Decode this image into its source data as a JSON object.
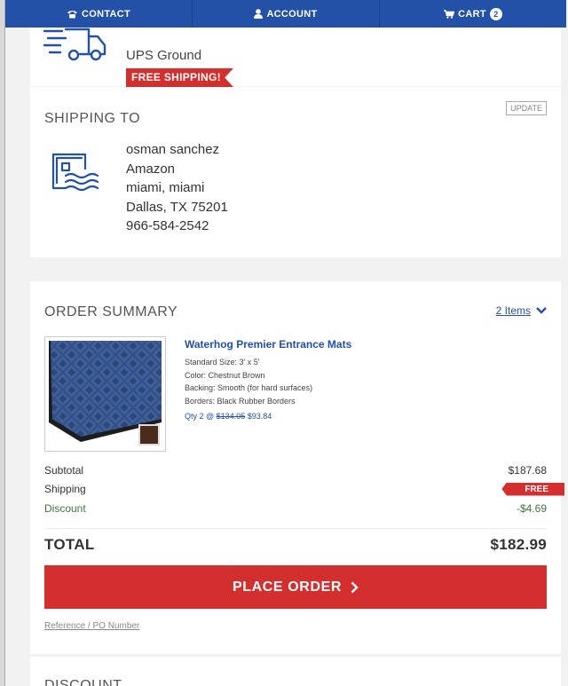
{
  "nav": {
    "contact": "CONTACT",
    "account": "ACCOUNT",
    "cart": "CART",
    "cart_count": "2"
  },
  "shipping_method": {
    "name": "UPS Ground",
    "badge": "FREE SHIPPING!"
  },
  "shipping_to": {
    "title": "SHIPPING TO",
    "update_label": "UPDATE",
    "address_lines": [
      "osman sanchez",
      "Amazon",
      "miami, miami",
      "Dallas, TX 75201",
      "966-584-2542"
    ]
  },
  "order_summary": {
    "title": "ORDER SUMMARY",
    "items_count": "2 Items",
    "product": {
      "name": "Waterhog Premier Entrance Mats",
      "attributes": [
        "Standard Size: 3' x 5'",
        "Color: Chestnut Brown",
        "Backing: Smooth (for hard surfaces)",
        "Borders: Black Rubber Borders"
      ],
      "qty_prefix": "Qty 2 @",
      "old_price": "$134.05",
      "new_price": "$93.84"
    },
    "subtotal_label": "Subtotal",
    "subtotal_value": "$187.68",
    "shipping_label": "Shipping",
    "shipping_value": "FREE",
    "discount_label": "Discount",
    "discount_value": "-$4.69",
    "total_label": "TOTAL",
    "total_value": "$182.99",
    "place_order_label": "PLACE ORDER",
    "reference_label": "Reference / PO Number"
  },
  "discount_section": {
    "title": "DISCOUNT"
  },
  "colors": {
    "nav_blue": "#2351a8",
    "accent_red": "#d32f2f",
    "discount_green": "#3b7a3b"
  },
  "icons": [
    "phone-icon",
    "user-icon",
    "cart-icon",
    "truck-icon",
    "address-icon",
    "chevron-down-icon",
    "chevron-right-icon"
  ]
}
